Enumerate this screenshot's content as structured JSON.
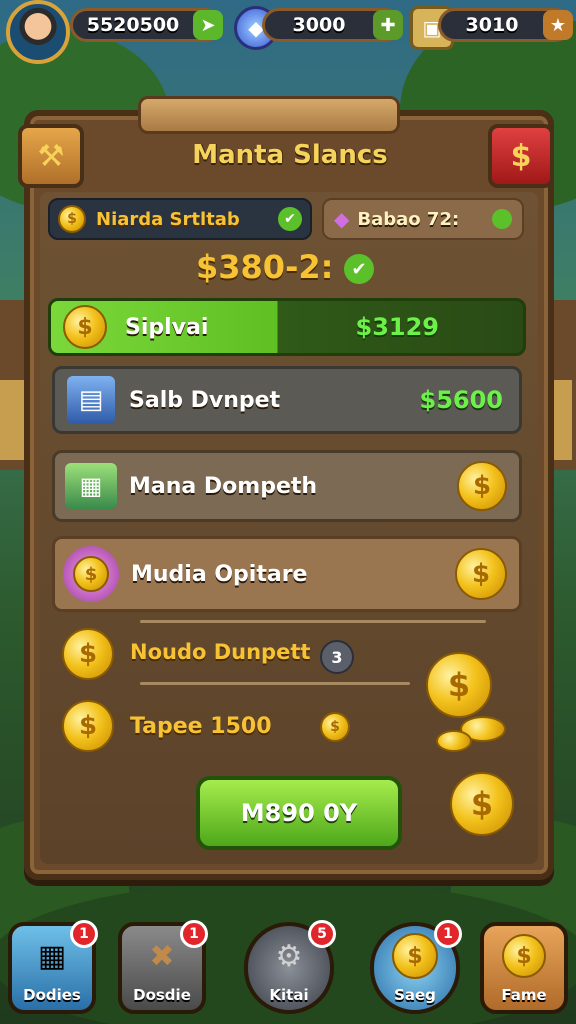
{
  "topbar": {
    "player_money": "5520500",
    "gems": "3000",
    "crates": "3010"
  },
  "panel": {
    "title": "Manta Slancs",
    "left_balance": "Niarda Srtltab",
    "right_balance": "Babao 72:",
    "total": "$380-2:"
  },
  "rows": [
    {
      "label": "Siplvai",
      "value": "$3129"
    },
    {
      "label": "Salb Dvnpet",
      "value": "$5600"
    },
    {
      "label": "Mana Dompeth",
      "value": ""
    },
    {
      "label": "Mudia Opitare",
      "value": ""
    }
  ],
  "list_items": [
    {
      "label": "Noudo Dunpett",
      "badge": "3"
    },
    {
      "label": "Tapee 1500"
    }
  ],
  "action_button": "M890 0Y",
  "nav": [
    {
      "label": "Dodies",
      "badge": "1"
    },
    {
      "label": "Dosdie",
      "badge": "1"
    },
    {
      "label": "Kitai",
      "badge": "5"
    },
    {
      "label": "Saeg",
      "badge": "1"
    },
    {
      "label": "Fame",
      "badge": ""
    }
  ],
  "colors": {
    "accent_green": "#4ea81a",
    "gold": "#f3c21c",
    "wood": "#6b4a2b",
    "badge_red": "#e0262a"
  }
}
